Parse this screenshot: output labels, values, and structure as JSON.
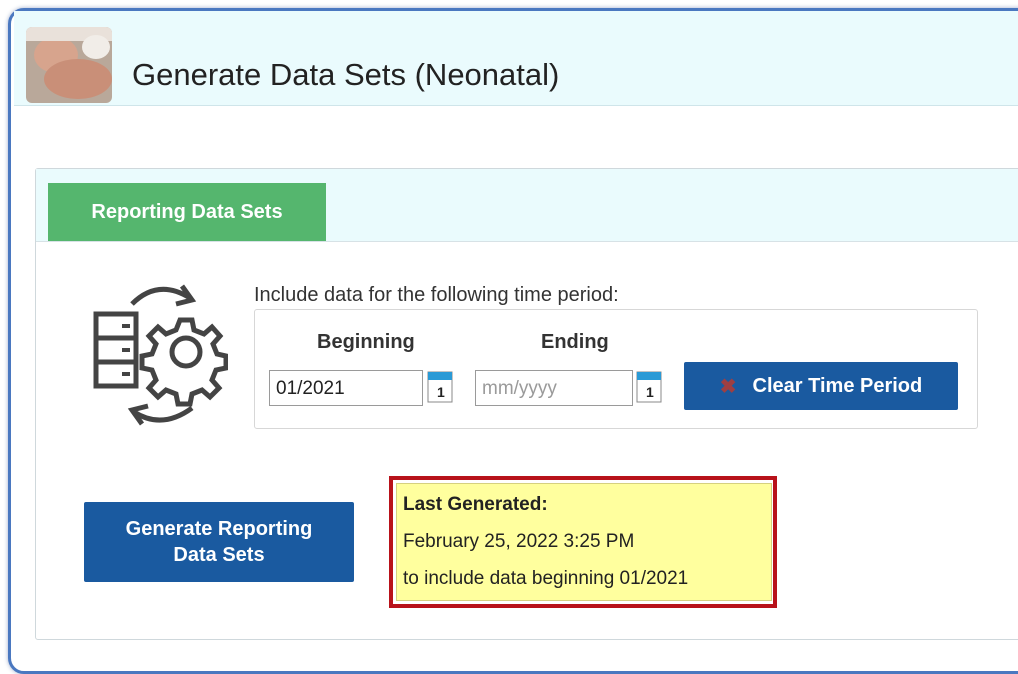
{
  "header": {
    "title": "Generate Data Sets (Neonatal)"
  },
  "tabs": [
    {
      "label": "Reporting Data Sets",
      "active": true
    }
  ],
  "period": {
    "prompt": "Include data for the following time period:",
    "beginning_label": "Beginning",
    "ending_label": "Ending",
    "beginning_value": "01/2021",
    "ending_placeholder": "mm/yyyy",
    "calendar_day": "1"
  },
  "buttons": {
    "clear": "Clear Time Period",
    "generate_line1": "Generate Reporting",
    "generate_line2": "Data Sets"
  },
  "last_generated": {
    "label": "Last Generated:",
    "datetime": "February 25, 2022 3:25 PM",
    "note": "to include data beginning 01/2021"
  },
  "colors": {
    "primary": "#1a5aa0",
    "tab_active": "#55b66e",
    "highlight": "#ffff9e",
    "callout_border": "#b8121a"
  },
  "icons": [
    "baby-photo",
    "data-gear-cycle-icon",
    "calendar-icon",
    "clear-x-icon"
  ]
}
